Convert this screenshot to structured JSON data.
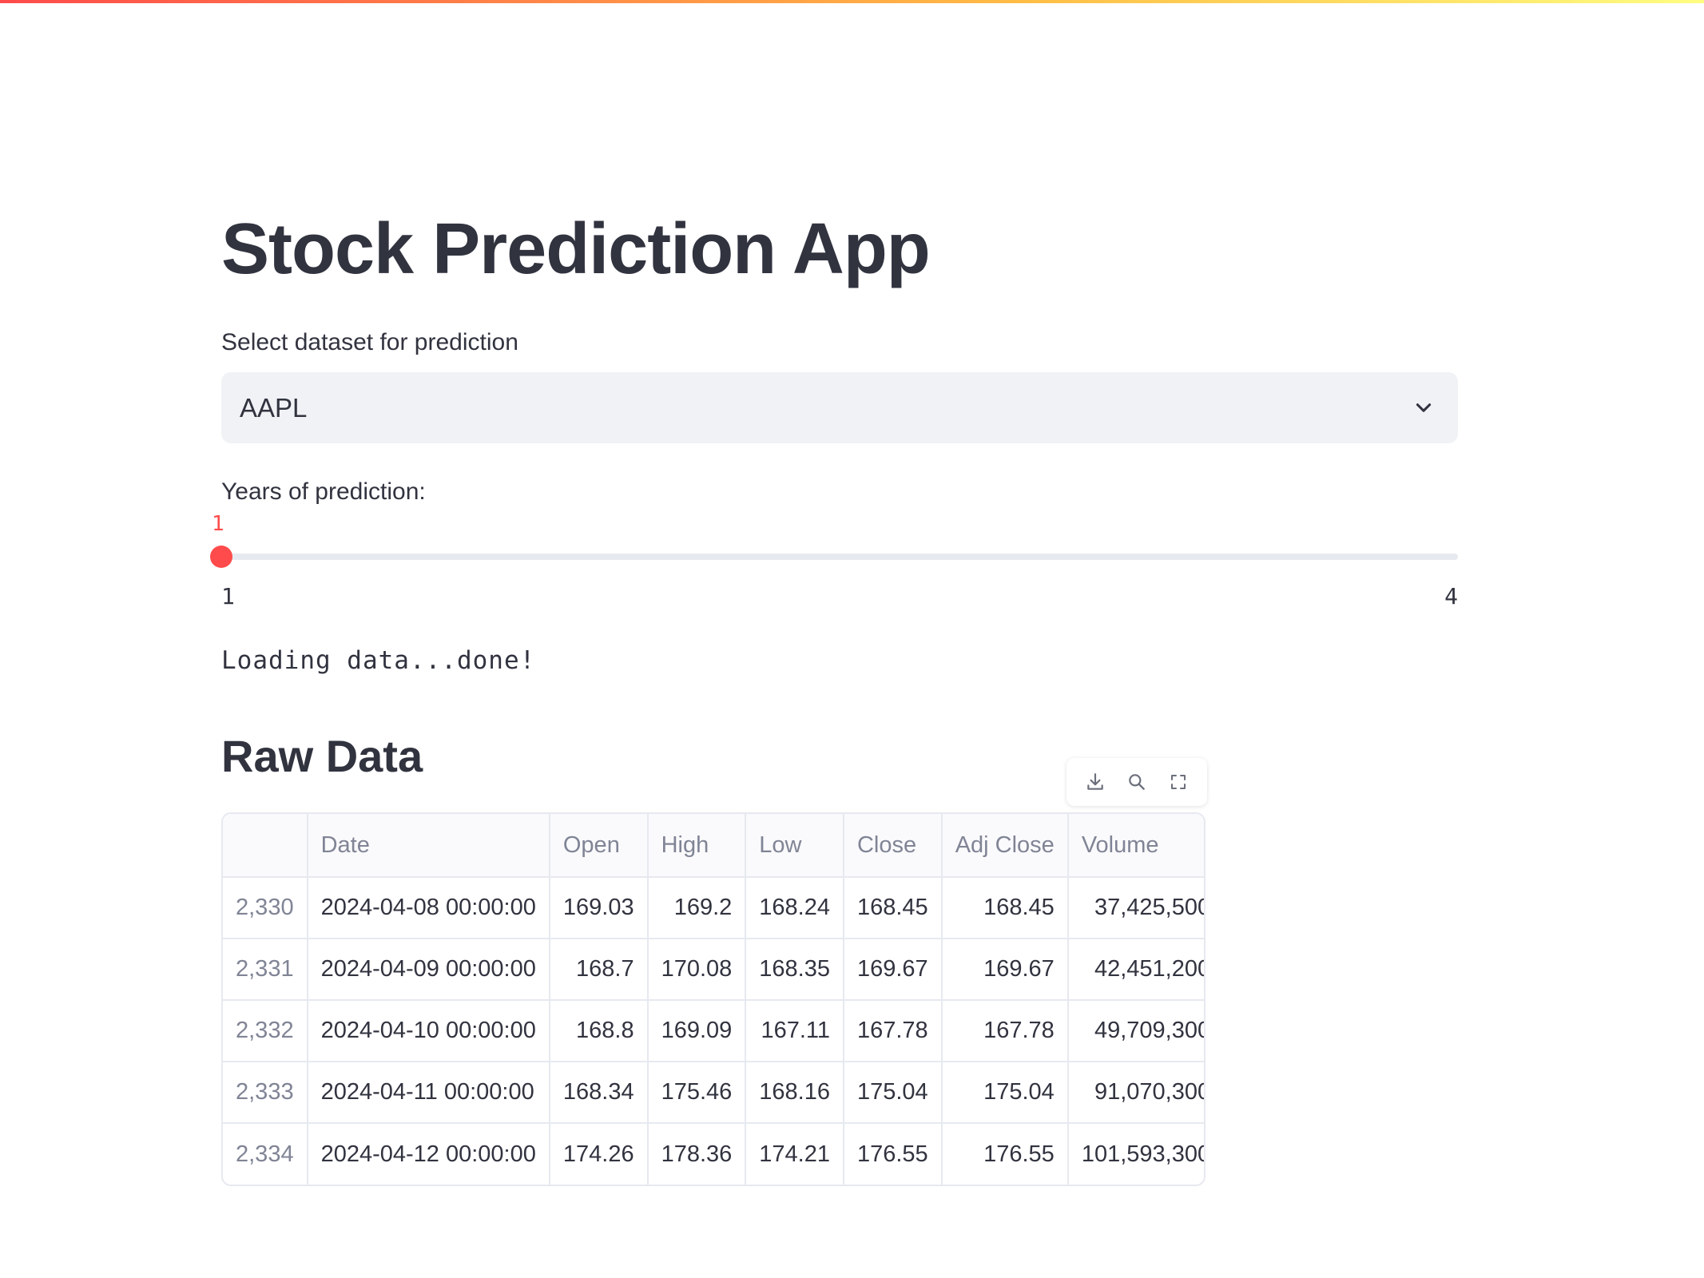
{
  "app": {
    "title": "Stock Prediction App"
  },
  "dataset_select": {
    "label": "Select dataset for prediction",
    "value": "AAPL"
  },
  "years_slider": {
    "label": "Years of prediction:",
    "value": 1,
    "value_text": "1",
    "min": 1,
    "max": 4,
    "min_label": "1",
    "max_label": "4",
    "accent_color": "#ff4b4b"
  },
  "status": {
    "loading_text": "Loading data...done!"
  },
  "raw_data": {
    "heading": "Raw Data",
    "toolbar_icons": [
      "download-icon",
      "search-icon",
      "fullscreen-icon"
    ],
    "columns": [
      "",
      "Date",
      "Open",
      "High",
      "Low",
      "Close",
      "Adj Close",
      "Volume"
    ],
    "rows": [
      [
        "2,330",
        "2024-04-08 00:00:00",
        "169.03",
        "169.2",
        "168.24",
        "168.45",
        "168.45",
        "37,425,500"
      ],
      [
        "2,331",
        "2024-04-09 00:00:00",
        "168.7",
        "170.08",
        "168.35",
        "169.67",
        "169.67",
        "42,451,200"
      ],
      [
        "2,332",
        "2024-04-10 00:00:00",
        "168.8",
        "169.09",
        "167.11",
        "167.78",
        "167.78",
        "49,709,300"
      ],
      [
        "2,333",
        "2024-04-11 00:00:00",
        "168.34",
        "175.46",
        "168.16",
        "175.04",
        "175.04",
        "91,070,300"
      ],
      [
        "2,334",
        "2024-04-12 00:00:00",
        "174.26",
        "178.36",
        "174.21",
        "176.55",
        "176.55",
        "101,593,300"
      ]
    ]
  }
}
